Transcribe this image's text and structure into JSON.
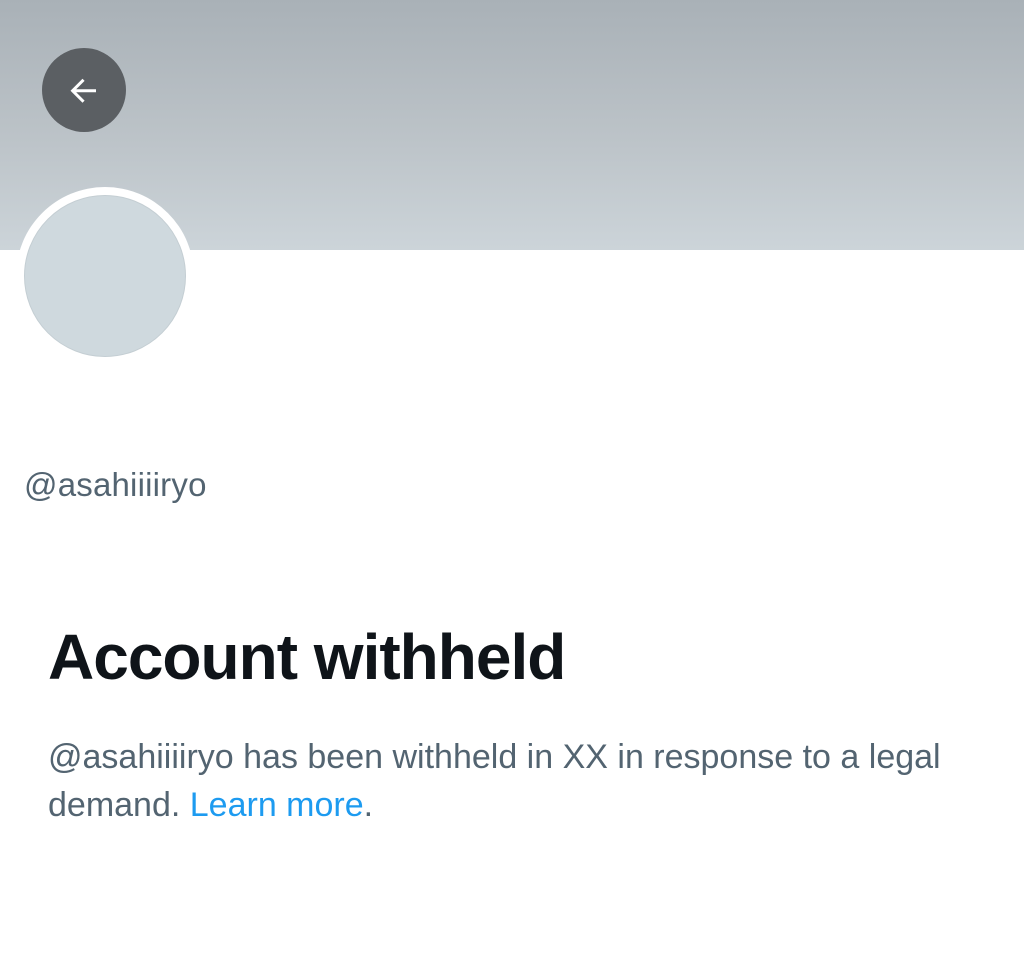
{
  "header": {
    "back_icon": "arrow-left-icon"
  },
  "profile": {
    "handle": "@asahiiiiryo"
  },
  "withheld": {
    "title": "Account withheld",
    "message": "@asahiiiiryo has been withheld in XX in response to a legal demand. ",
    "link_label": "Learn more",
    "trailing": "."
  },
  "colors": {
    "link": "#1d9bf0",
    "secondary_text": "#536471",
    "primary_text": "#0f1419",
    "back_button_bg": "#5b5f63"
  }
}
